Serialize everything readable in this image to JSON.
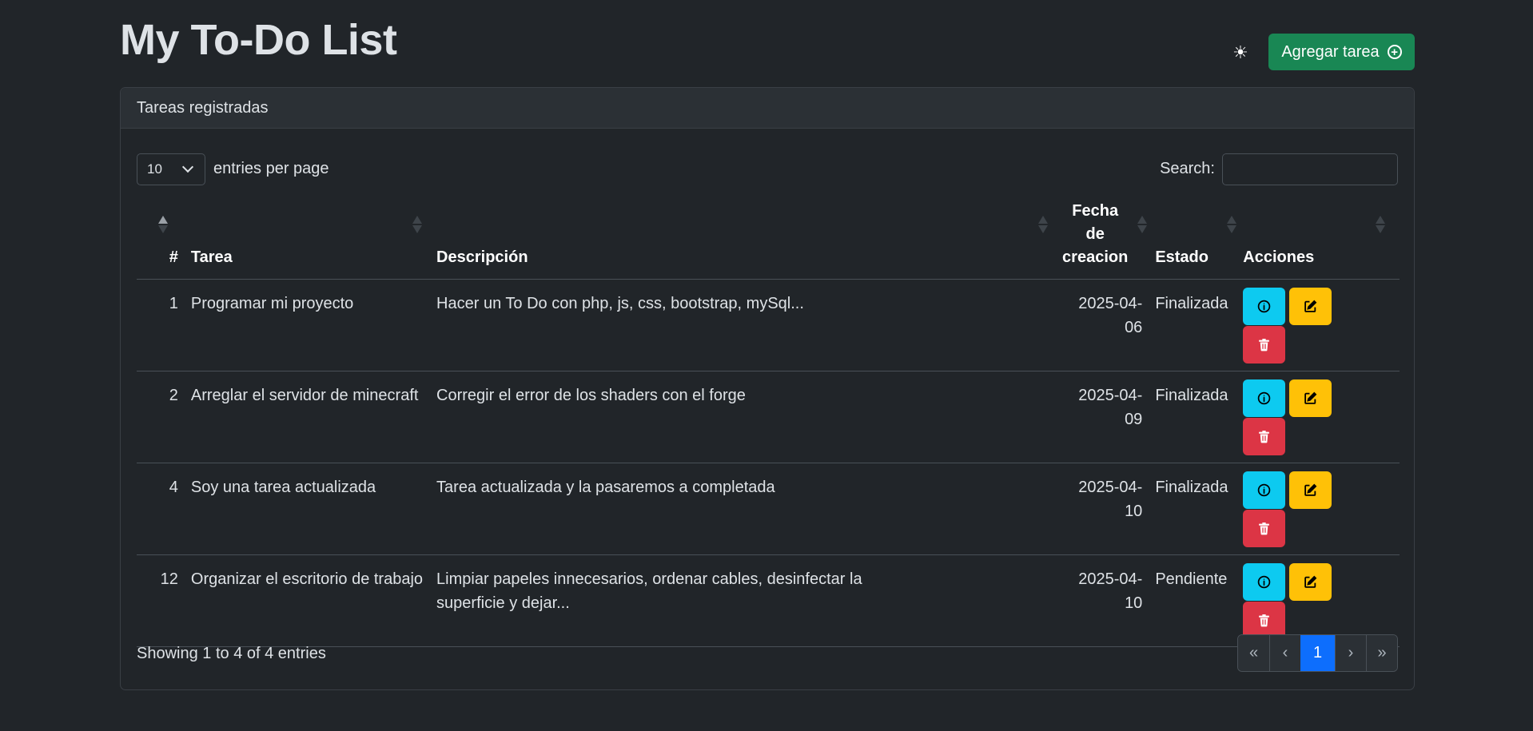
{
  "app": {
    "title": "My To-Do List",
    "theme_icon": "sun-icon",
    "add_button_label": "Agregar tarea",
    "add_button_icon": "plus-circle-icon"
  },
  "card": {
    "header": "Tareas registradas"
  },
  "controls": {
    "page_length_value": "10",
    "page_length_label": "entries per page",
    "search_label": "Search:",
    "search_value": ""
  },
  "table": {
    "columns": [
      "#",
      "Tarea",
      "Descripción",
      "Fecha de creacion",
      "Estado",
      "Acciones"
    ],
    "rows": [
      {
        "id": "1",
        "tarea": "Programar mi proyecto",
        "descripcion": "Hacer un To Do con php, js, css, bootstrap, mySql...",
        "fecha": "2025-04-06",
        "estado": "Finalizada"
      },
      {
        "id": "2",
        "tarea": "Arreglar el servidor de minecraft",
        "descripcion": "Corregir el error de los shaders con el forge",
        "fecha": "2025-04-09",
        "estado": "Finalizada"
      },
      {
        "id": "4",
        "tarea": "Soy una tarea actualizada",
        "descripcion": "Tarea actualizada y la pasaremos a completada",
        "fecha": "2025-04-10",
        "estado": "Finalizada"
      },
      {
        "id": "12",
        "tarea": "Organizar el escritorio de trabajo",
        "descripcion": "Limpiar papeles innecesarios, ordenar cables, desinfectar la superficie y dejar...",
        "fecha": "2025-04-10",
        "estado": "Pendiente"
      }
    ]
  },
  "footer": {
    "info": "Showing 1 to 4 of 4 entries",
    "pagination": {
      "first": "«",
      "prev": "‹",
      "current": "1",
      "next": "›",
      "last": "»"
    }
  },
  "colors": {
    "background": "#212529",
    "success": "#198754",
    "info": "#0dcaf0",
    "warning": "#ffc107",
    "danger": "#dc3545",
    "primary": "#0d6efd"
  }
}
